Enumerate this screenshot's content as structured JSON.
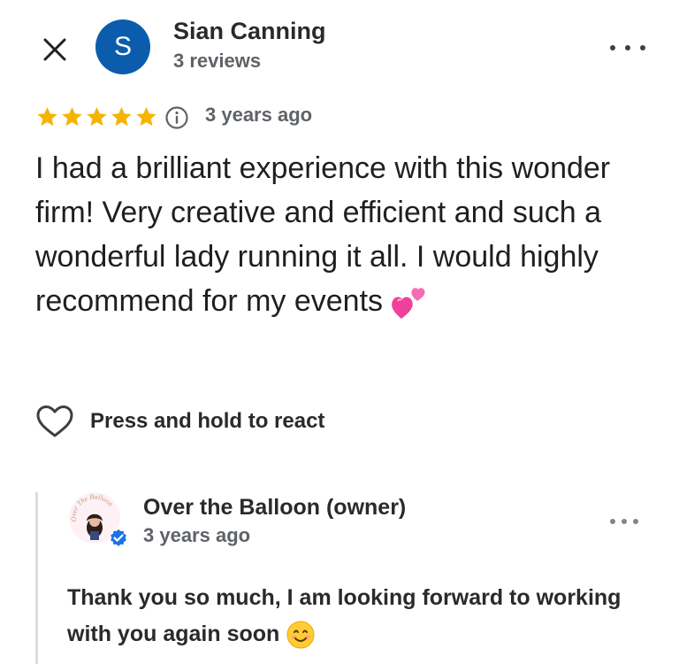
{
  "header": {
    "avatar_letter": "S",
    "avatar_color": "#0b5cad",
    "reviewer_name": "Sian Canning",
    "review_count": "3 reviews",
    "close_icon": "close-icon",
    "more_icon": "more-horizontal-icon"
  },
  "rating": {
    "stars": 5,
    "max_stars": 5,
    "star_color": "#f4b400",
    "time_ago": "3 years ago"
  },
  "review": {
    "text": "I had a brilliant experience with this wonder firm! Very creative and efficient and such a wonderful lady running it all. I would highly recommend for my events",
    "emoji": "two-hearts-emoji"
  },
  "react": {
    "label": "Press and hold to react",
    "icon": "heart-outline-icon"
  },
  "owner_reply": {
    "name": "Over the Balloon (owner)",
    "time_ago": "3 years ago",
    "text": "Thank you so much, I am looking forward to working with you again soon",
    "emoji": "smiling-face-emoji",
    "verified_color": "#1a73e8",
    "logo_text": "Over The Balloon"
  }
}
